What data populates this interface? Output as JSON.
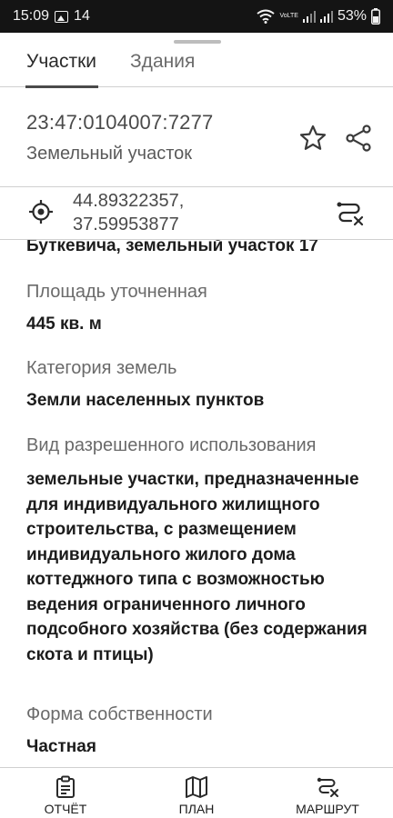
{
  "status_bar": {
    "time": "15:09",
    "notification_count": "14",
    "network": "VoLTE",
    "battery": "53%"
  },
  "tabs": [
    {
      "label": "Участки",
      "active": true
    },
    {
      "label": "Здания",
      "active": false
    }
  ],
  "parcel": {
    "cadastral_number": "23:47:0104007:7277",
    "type": "Земельный участок"
  },
  "coordinates": {
    "lat": "44.89322357,",
    "lon": "37.59953877"
  },
  "details": {
    "address_tail": "Буткевича, земельный участок 17",
    "area_label": "Площадь уточненная",
    "area_value": "445 кв. м",
    "category_label": "Категория земель",
    "category_value": "Земли населенных пунктов",
    "usage_label": "Вид разрешенного использования",
    "usage_value": "земельные участки, предназначенные для индивидуального жилищного строительства, с размещением индивидуального жилого дома коттеджного типа с возможностью ведения ограниченного личного подсобного хозяйства (без содержания скота и птицы)",
    "ownership_label": "Форма собственности",
    "ownership_value": "Частная"
  },
  "bottom_nav": [
    {
      "label": "ОТЧЁТ",
      "icon": "clipboard-icon"
    },
    {
      "label": "ПЛАН",
      "icon": "map-icon"
    },
    {
      "label": "МАРШРУТ",
      "icon": "route-icon"
    }
  ],
  "colors": {
    "status_bar_bg": "#141414",
    "text_primary": "#1c1c1c",
    "text_secondary": "#6a6a6a",
    "divider": "#d0d0d0"
  }
}
